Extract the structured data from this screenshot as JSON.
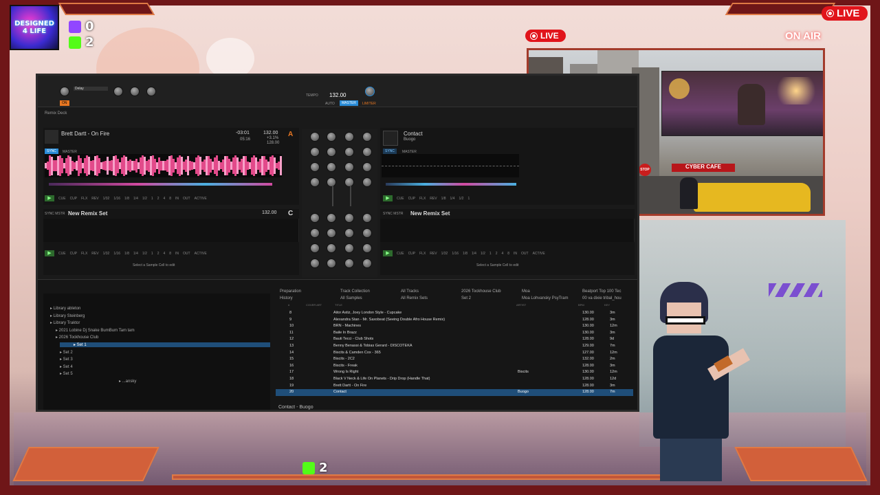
{
  "overlay": {
    "logo_text": "DESIGNED 4 LIFE",
    "twitch_count": "0",
    "kick_count": "2",
    "kick_bottom_count": "2",
    "live_top_right": "LIVE",
    "live_camera": "LIVE",
    "on_air": "ON AIR"
  },
  "camera": {
    "sign_text": "CYBER CAFE",
    "stop_sign": "STOP"
  },
  "traktor": {
    "master": {
      "bpm": "132.00",
      "auto_label": "AUTO",
      "master_label": "MASTER",
      "limiter_label": "LIMITER",
      "on_label": "ON",
      "delay_label": "Delay",
      "tempo_label": "TEMPO"
    },
    "deck_a": {
      "section_label": "Remix Deck",
      "title": "Brett Dartt - On Fire",
      "time": "-03:01",
      "time2": "05:16",
      "bpm": "132.00",
      "pitch": "+3.1%",
      "base_bpm": "128.00",
      "letter": "A",
      "sync": "SYNC",
      "master": "MASTER",
      "transport": [
        "CUE",
        "CUP",
        "FLX",
        "REV",
        "1/32",
        "1/16",
        "1/8",
        "1/4",
        "1/2",
        "1",
        "2",
        "4",
        "8",
        "IN",
        "OUT",
        "ACTIVE"
      ]
    },
    "deck_b": {
      "title": "Contact",
      "artist": "Buogo",
      "sync": "SYNC",
      "master": "MASTER",
      "transport": [
        "CUE",
        "CUP",
        "FLX",
        "REV",
        "1/8",
        "1/4",
        "1/2",
        "1"
      ]
    },
    "deck_c": {
      "title": "New Remix Set",
      "bpm": "132.00",
      "letter": "C",
      "prefix": "SYNC MSTR",
      "hint": "Select a Sample Cell to edit"
    },
    "deck_d": {
      "title": "New Remix Set",
      "prefix": "SYNC MSTR",
      "hint": "Select a Sample Cell to edit"
    },
    "browser": {
      "favorites": [
        "Preparation",
        "History",
        "Track Collection",
        "All Samples",
        "All Tracks",
        "All Remix Sets",
        "2026 Tockhouse Club",
        "Set 2",
        "Moa",
        "Moa Lohvansky PsyTram",
        "Beatport Top 100 Tec",
        "00 va dixie tribal_hou"
      ],
      "tree": [
        "Library ableton",
        "Library Steinberg",
        "Library Traktor",
        "2021 Lobine Dj Snake BumBum Tam tam",
        "2026 Tockhouse Club",
        "Set 1",
        "Set 2",
        "Set 3",
        "Set 4",
        "Set 5",
        "...ansky"
      ],
      "selected_tree_index": 5,
      "columns": [
        "#",
        "COVER ART",
        "TITLE",
        "ARTIST",
        "BPM",
        "KEY"
      ],
      "tracks": [
        {
          "num": "8",
          "title": "Aitor Astiz, Joey London Style - Cupcake",
          "artist": "",
          "bpm": "130.00",
          "key": "3m"
        },
        {
          "num": "9",
          "title": "Alexandra Stan - Mr. Saxobeat (Seeing Double Afro House Remix)",
          "artist": "",
          "bpm": "128.00",
          "key": "3m"
        },
        {
          "num": "10",
          "title": "BRN - Machines",
          "artist": "",
          "bpm": "130.00",
          "key": "12m"
        },
        {
          "num": "11",
          "title": "Baile In Brazz",
          "artist": "",
          "bpm": "130.00",
          "key": "3m"
        },
        {
          "num": "12",
          "title": "Bauti Tecci - Club Shots",
          "artist": "",
          "bpm": "128.00",
          "key": "9d"
        },
        {
          "num": "13",
          "title": "Benny Benassi & Tobias Gerard - DISCOTEKA",
          "artist": "",
          "bpm": "129.00",
          "key": "7m"
        },
        {
          "num": "14",
          "title": "Biscits & Camden Cox - 365",
          "artist": "",
          "bpm": "127.00",
          "key": "12m"
        },
        {
          "num": "15",
          "title": "Biscits - 2C2",
          "artist": "",
          "bpm": "132.00",
          "key": "2m"
        },
        {
          "num": "16",
          "title": "Biscits - Freak",
          "artist": "",
          "bpm": "128.00",
          "key": "3m"
        },
        {
          "num": "17",
          "title": "Wrong Is Right",
          "artist": "Biscits",
          "bpm": "130.00",
          "key": "12m"
        },
        {
          "num": "18",
          "title": "Black V Neck & Life On Planets - Drip Drop (Handle That)",
          "artist": "",
          "bpm": "128.00",
          "key": "12d"
        },
        {
          "num": "19",
          "title": "Brett Dartt - On Fire",
          "artist": "",
          "bpm": "128.00",
          "key": "3m"
        },
        {
          "num": "20",
          "title": "Contact",
          "artist": "Buogo",
          "bpm": "128.00",
          "key": "7m"
        }
      ],
      "loaded_index": 12,
      "status": "Contact - Buogo"
    }
  }
}
